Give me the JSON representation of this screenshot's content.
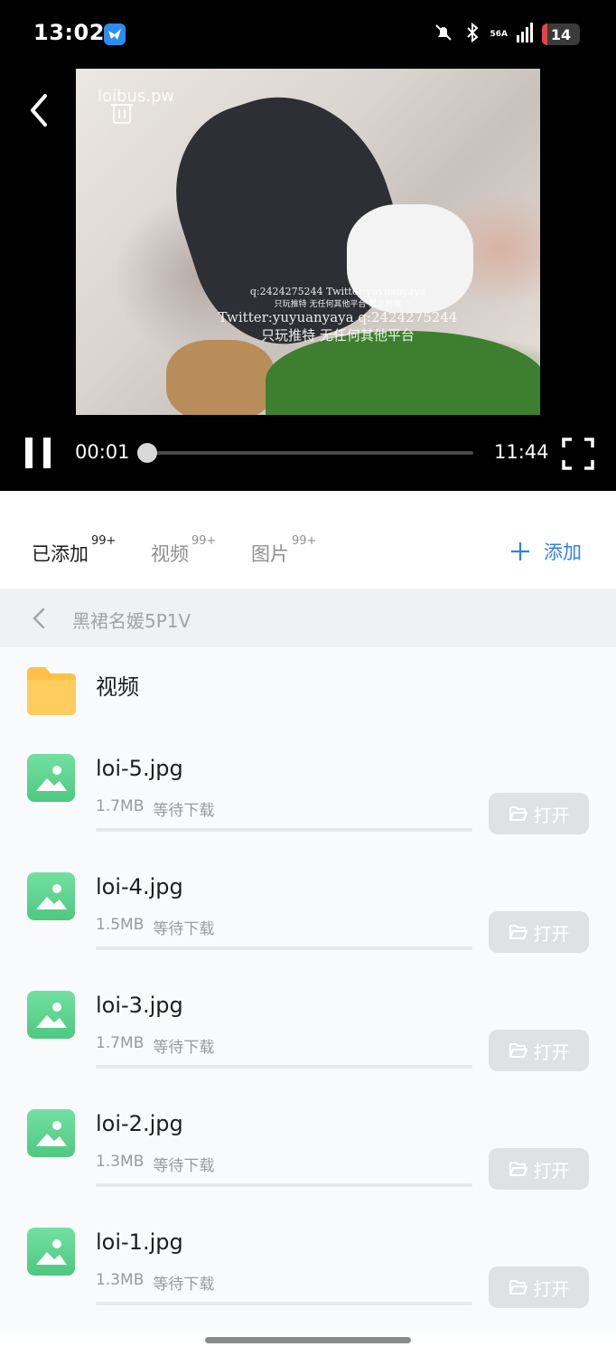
{
  "status_bar": {
    "time": "13:02",
    "network": "56A",
    "battery": "14",
    "battery_level": 0.14
  },
  "player": {
    "watermark_site": "loibus.pw",
    "watermark_lines": [
      "q:2424275244 Twitter:yuyuanyaya",
      "只玩推特 无任何其他平台 禁止转载",
      "Twitter:yuyuanyaya q:2424275244",
      "只玩推特 无任何其他平台"
    ],
    "current_time": "00:01",
    "total_time": "11:44",
    "progress": 0.0014
  },
  "tabs": [
    {
      "label": "已添加",
      "badge": "99+",
      "active": true
    },
    {
      "label": "视频",
      "badge": "99+",
      "active": false
    },
    {
      "label": "图片",
      "badge": "99+",
      "active": false
    }
  ],
  "add_button": "添加",
  "breadcrumb": {
    "title": "黑裙名媛5P1V"
  },
  "folder": {
    "name": "视频"
  },
  "files": [
    {
      "name": "loi-5.jpg",
      "size": "1.7MB",
      "status": "等待下载",
      "progress": 0,
      "action": "打开"
    },
    {
      "name": "loi-4.jpg",
      "size": "1.5MB",
      "status": "等待下载",
      "progress": 0,
      "action": "打开"
    },
    {
      "name": "loi-3.jpg",
      "size": "1.7MB",
      "status": "等待下载",
      "progress": 0,
      "action": "打开"
    },
    {
      "name": "loi-2.jpg",
      "size": "1.3MB",
      "status": "等待下载",
      "progress": 0,
      "action": "打开"
    },
    {
      "name": "loi-1.jpg",
      "size": "1.3MB",
      "status": "等待下载",
      "progress": 0,
      "action": "打开"
    }
  ],
  "colors": {
    "accent": "#2f7ff0",
    "folder": "#ffc048",
    "image_icon": "#5dd38d",
    "battery_low": "#e64545"
  }
}
